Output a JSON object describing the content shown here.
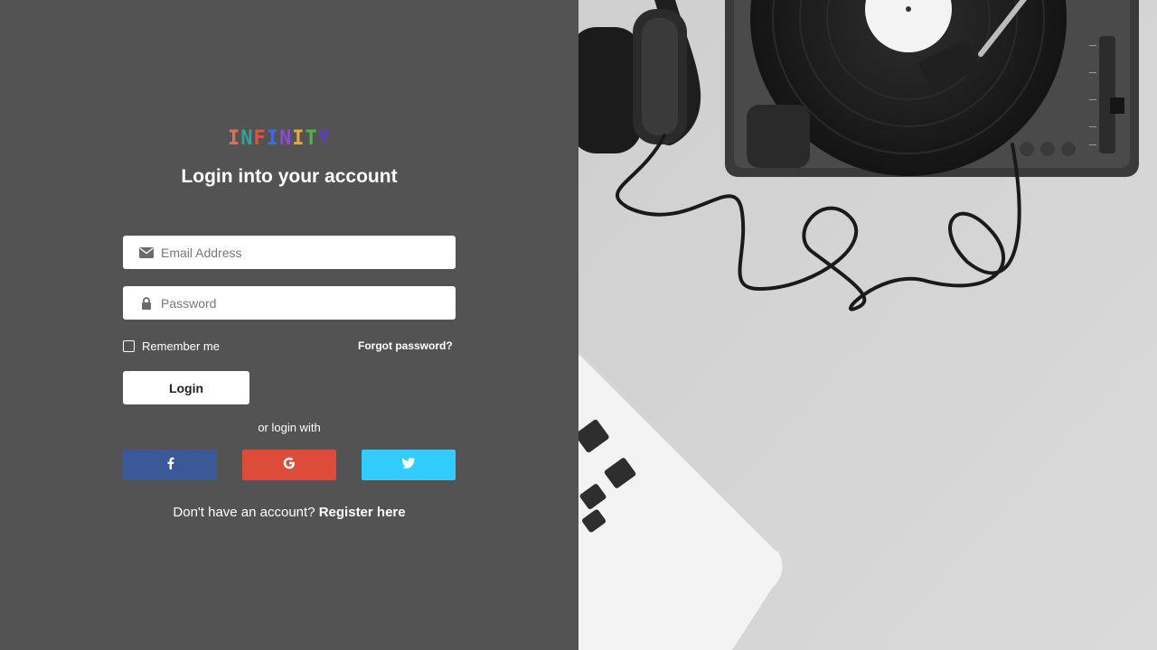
{
  "logo": {
    "letters": [
      "I",
      "N",
      "F",
      "I",
      "N",
      "I",
      "T",
      "Y"
    ],
    "colors": [
      "#e36f5b",
      "#2ea39a",
      "#e3503b",
      "#3d6fd6",
      "#8c4cc4",
      "#e3a93b",
      "#4bb749",
      "#5b3cc4"
    ]
  },
  "heading": "Login into your account",
  "email": {
    "placeholder": "Email Address",
    "icon": "envelope-icon"
  },
  "password": {
    "placeholder": "Password",
    "icon": "lock-icon"
  },
  "remember_label": "Remember me",
  "forgot_label": "Forgot password?",
  "login_label": "Login",
  "or_login_with": "or login with",
  "social": [
    {
      "name": "facebook",
      "icon": "facebook-icon",
      "color": "#3b5998"
    },
    {
      "name": "google",
      "icon": "google-icon",
      "color": "#dd4b39"
    },
    {
      "name": "twitter",
      "icon": "twitter-icon",
      "color": "#33ccff"
    }
  ],
  "register": {
    "prompt": "Don't have an account?",
    "link": "Register here"
  }
}
